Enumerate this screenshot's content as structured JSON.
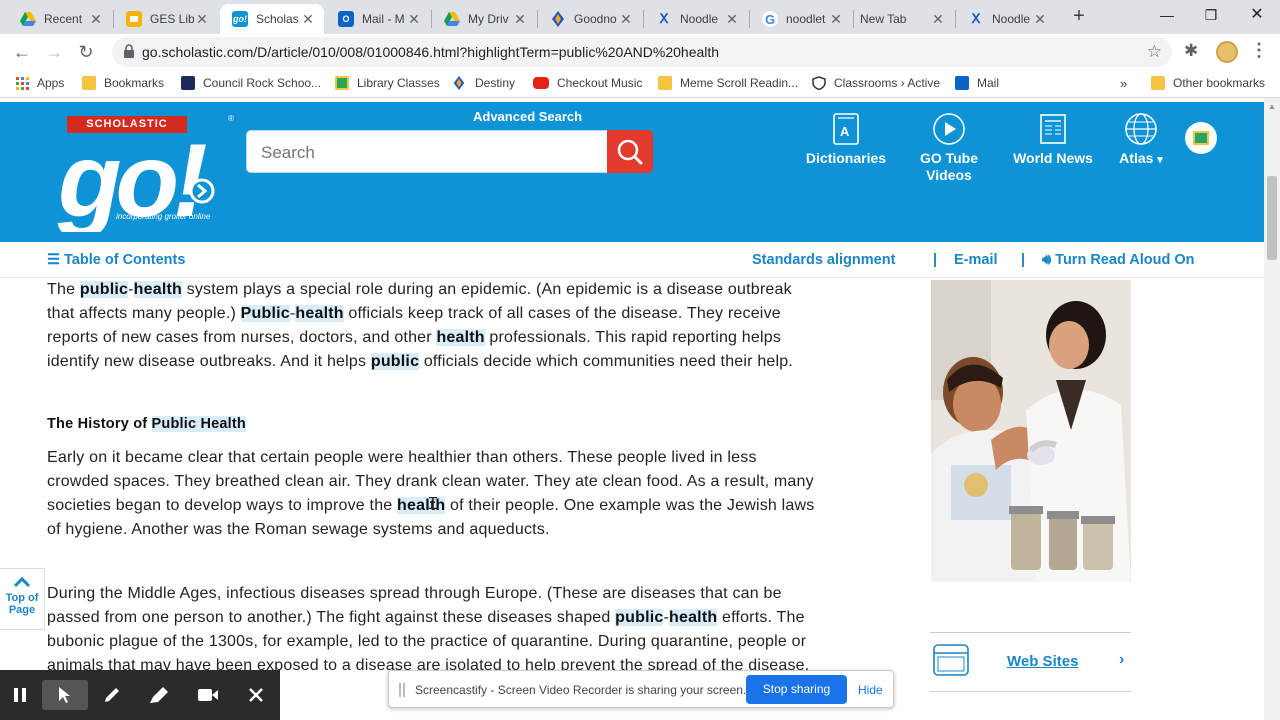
{
  "browser": {
    "tabs": [
      {
        "title": "Recent",
        "icon": "google-drive-icon",
        "active": false
      },
      {
        "title": "GES Lib",
        "icon": "google-slides-icon",
        "active": false
      },
      {
        "title": "Scholas",
        "icon": "scholastic-go-icon",
        "active": true
      },
      {
        "title": "Mail - M",
        "icon": "outlook-mail-icon",
        "active": false
      },
      {
        "title": "My Driv",
        "icon": "google-drive-icon",
        "active": false
      },
      {
        "title": "Goodno",
        "icon": "destiny-icon",
        "active": false
      },
      {
        "title": "Noodle",
        "icon": "noodletools-icon",
        "active": false
      },
      {
        "title": "noodlet",
        "icon": "google-search-icon",
        "active": false
      },
      {
        "title": "New Tab",
        "icon": "",
        "active": false
      },
      {
        "title": "Noodle",
        "icon": "noodletools-icon",
        "active": false
      }
    ],
    "url": "go.scholastic.com/D/article/010/008/01000846.html?highlightTerm=public%20AND%20health",
    "bookmarks": [
      {
        "label": "Apps",
        "icon": "apps-grid-icon"
      },
      {
        "label": "Bookmarks",
        "icon": "folder-icon"
      },
      {
        "label": "Council Rock Schoo...",
        "icon": "council-rock-icon"
      },
      {
        "label": "Library Classes",
        "icon": "library-classes-icon"
      },
      {
        "label": "Destiny",
        "icon": "destiny-icon"
      },
      {
        "label": "Checkout Music",
        "icon": "youtube-icon"
      },
      {
        "label": "Meme Scroll Readin...",
        "icon": "folder-icon"
      },
      {
        "label": "Classrooms › Active",
        "icon": "shield-icon"
      },
      {
        "label": "Mail",
        "icon": "outlook-mail-icon"
      }
    ],
    "other_bookmarks": "Other bookmarks",
    "overflow": "»"
  },
  "header": {
    "brand_badge": "SCHOLASTIC",
    "logo_text": "go!",
    "tagline": "incorporating grolier online",
    "advanced_search": "Advanced Search",
    "search_placeholder": "Search",
    "nav": [
      {
        "label": "Dictionaries",
        "icon": "dictionary-icon"
      },
      {
        "label": "GO Tube Videos",
        "icon": "play-icon"
      },
      {
        "label": "World News",
        "icon": "newspaper-icon"
      },
      {
        "label": "Atlas",
        "icon": "globe-icon"
      }
    ],
    "atlas_caret": "▾"
  },
  "toc_bar": {
    "toc_label": "Table of Contents",
    "standards": "Standards alignment",
    "separator": "|",
    "email": "E-mail",
    "read_aloud": "Turn Read Aloud On"
  },
  "article": {
    "heading": "The History of Public Health",
    "colors": {
      "highlight": "#d9ecfa",
      "link": "#1a86c8",
      "header_bg": "#0d93d6",
      "search_button": "#e23a2c"
    }
  },
  "sidebar": {
    "websites_label": "Web Sites"
  },
  "top_of_page": {
    "line1": "Top of",
    "line2": "Page"
  },
  "screencastify": {
    "message": "Screencastify - Screen Video Recorder is sharing your screen.",
    "stop_button": "Stop sharing",
    "hide_button": "Hide"
  }
}
